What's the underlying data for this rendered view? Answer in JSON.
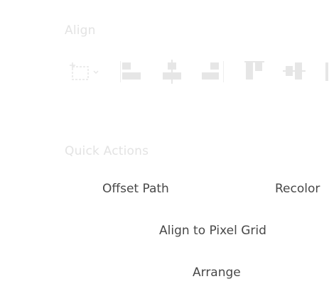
{
  "align": {
    "title": "Align",
    "icons": [
      "align-to-selection-icon",
      "horizontal-align-left-icon",
      "horizontal-align-center-icon",
      "horizontal-align-right-icon",
      "vertical-align-top-icon",
      "vertical-align-center-icon",
      "vertical-align-bottom-icon"
    ]
  },
  "quick_actions": {
    "title": "Quick Actions",
    "offset_path": "Offset Path",
    "recolor": "Recolor",
    "align_pixel_grid": "Align to Pixel Grid",
    "arrange": "Arrange"
  },
  "colors": {
    "disabled": "#e3e3e3",
    "text": "#484848",
    "background": "#ffffff"
  }
}
